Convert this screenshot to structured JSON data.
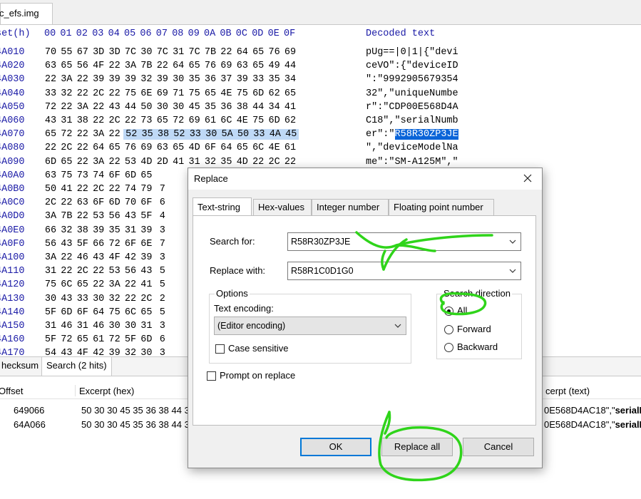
{
  "editor": {
    "file_tab": "c_efs.img",
    "header": {
      "offset_label": "set(h)",
      "columns": [
        "00",
        "01",
        "02",
        "03",
        "04",
        "05",
        "06",
        "07",
        "08",
        "09",
        "0A",
        "0B",
        "0C",
        "0D",
        "0E",
        "0F"
      ],
      "decoded_label": "Decoded text"
    },
    "rows": [
      {
        "offset": "4A010",
        "hex": [
          "70",
          "55",
          "67",
          "3D",
          "3D",
          "7C",
          "30",
          "7C",
          "31",
          "7C",
          "7B",
          "22",
          "64",
          "65",
          "76",
          "69"
        ],
        "text": "pUg==|0|1|{\"devi"
      },
      {
        "offset": "4A020",
        "hex": [
          "63",
          "65",
          "56",
          "4F",
          "22",
          "3A",
          "7B",
          "22",
          "64",
          "65",
          "76",
          "69",
          "63",
          "65",
          "49",
          "44"
        ],
        "text": "ceVO\":{\"deviceID"
      },
      {
        "offset": "4A030",
        "hex": [
          "22",
          "3A",
          "22",
          "39",
          "39",
          "39",
          "32",
          "39",
          "30",
          "35",
          "36",
          "37",
          "39",
          "33",
          "35",
          "34"
        ],
        "text": "\":\"9992905679354"
      },
      {
        "offset": "4A040",
        "hex": [
          "33",
          "32",
          "22",
          "2C",
          "22",
          "75",
          "6E",
          "69",
          "71",
          "75",
          "65",
          "4E",
          "75",
          "6D",
          "62",
          "65"
        ],
        "text": "32\",\"uniqueNumbe"
      },
      {
        "offset": "4A050",
        "hex": [
          "72",
          "22",
          "3A",
          "22",
          "43",
          "44",
          "50",
          "30",
          "30",
          "45",
          "35",
          "36",
          "38",
          "44",
          "34",
          "41"
        ],
        "text": "r\":\"CDP00E568D4A"
      },
      {
        "offset": "4A060",
        "hex": [
          "43",
          "31",
          "38",
          "22",
          "2C",
          "22",
          "73",
          "65",
          "72",
          "69",
          "61",
          "6C",
          "4E",
          "75",
          "6D",
          "62"
        ],
        "text": "C18\",\"serialNumb"
      },
      {
        "offset": "4A070",
        "hex": [
          "65",
          "72",
          "22",
          "3A",
          "22",
          "52",
          "35",
          "38",
          "52",
          "33",
          "30",
          "5A",
          "50",
          "33",
          "4A",
          "45"
        ],
        "text_plain": "er\":\"",
        "text_sel": "R58R30ZP3JE"
      },
      {
        "offset": "4A080",
        "hex": [
          "22",
          "2C",
          "22",
          "64",
          "65",
          "76",
          "69",
          "63",
          "65",
          "4D",
          "6F",
          "64",
          "65",
          "6C",
          "4E",
          "61"
        ],
        "text": "\",\"deviceModelNa"
      },
      {
        "offset": "4A090",
        "hex": [
          "6D",
          "65",
          "22",
          "3A",
          "22",
          "53",
          "4D",
          "2D",
          "41",
          "31",
          "32",
          "35",
          "4D",
          "22",
          "2C",
          "22"
        ],
        "text": "me\":\"SM-A125M\",\""
      },
      {
        "offset": "4A0A0",
        "hex": [
          "63",
          "75",
          "73",
          "74",
          "6F",
          "6D",
          "65"
        ]
      },
      {
        "offset": "4A0B0",
        "hex": [
          "50",
          "41",
          "22",
          "2C",
          "22",
          "74",
          "79",
          "7"
        ]
      },
      {
        "offset": "4A0C0",
        "hex": [
          "2C",
          "22",
          "63",
          "6F",
          "6D",
          "70",
          "6F",
          "6"
        ]
      },
      {
        "offset": "4A0D0",
        "hex": [
          "3A",
          "7B",
          "22",
          "53",
          "56",
          "43",
          "5F",
          "4"
        ]
      },
      {
        "offset": "4A0E0",
        "hex": [
          "66",
          "32",
          "38",
          "39",
          "35",
          "31",
          "39",
          "3"
        ]
      },
      {
        "offset": "4A0F0",
        "hex": [
          "56",
          "43",
          "5F",
          "66",
          "72",
          "6F",
          "6E",
          "7"
        ]
      },
      {
        "offset": "4A100",
        "hex": [
          "3A",
          "22",
          "46",
          "43",
          "4F",
          "42",
          "39",
          "3"
        ]
      },
      {
        "offset": "4A110",
        "hex": [
          "31",
          "22",
          "2C",
          "22",
          "53",
          "56",
          "43",
          "5"
        ]
      },
      {
        "offset": "4A120",
        "hex": [
          "75",
          "6C",
          "65",
          "22",
          "3A",
          "22",
          "41",
          "5"
        ]
      },
      {
        "offset": "4A130",
        "hex": [
          "30",
          "43",
          "33",
          "30",
          "32",
          "22",
          "2C",
          "2"
        ]
      },
      {
        "offset": "4A140",
        "hex": [
          "5F",
          "6D",
          "6F",
          "64",
          "75",
          "6C",
          "65",
          "5"
        ]
      },
      {
        "offset": "4A150",
        "hex": [
          "31",
          "46",
          "31",
          "46",
          "30",
          "30",
          "31",
          "3"
        ]
      },
      {
        "offset": "4A160",
        "hex": [
          "5F",
          "72",
          "65",
          "61",
          "72",
          "5F",
          "6D",
          "6"
        ]
      },
      {
        "offset": "4A170",
        "hex": [
          "54",
          "43",
          "4F",
          "42",
          "39",
          "32",
          "30",
          "3"
        ]
      }
    ]
  },
  "bottom_panel": {
    "tabs": [
      "hecksum",
      "Search (2 hits)"
    ],
    "columns": {
      "offset": "Offset",
      "excerpt_hex": "Excerpt (hex)",
      "excerpt_text": "cerpt (text)"
    },
    "results": [
      {
        "offset": "649066",
        "hex": "50 30 30 45 35 36 38 44 34",
        "text_plain": "0E568D4AC18\",\"",
        "text_bold": "serialN"
      },
      {
        "offset": "64A066",
        "hex": "50 30 30 45 35 36 38 44 34",
        "text_plain": "0E568D4AC18\",\"",
        "text_bold": "serialN"
      }
    ]
  },
  "dialog": {
    "title": "Replace",
    "tabs": [
      "Text-string",
      "Hex-values",
      "Integer number",
      "Floating point number"
    ],
    "search_label": "Search for:",
    "search_value": "R58R30ZP3JE",
    "replace_label": "Replace with:",
    "replace_value": "R58R1C0D1G0",
    "options_title": "Options",
    "encoding_label": "Text encoding:",
    "encoding_value": "(Editor encoding)",
    "case_label": "Case sensitive",
    "direction_title": "Search direction",
    "direction_options": [
      "All",
      "Forward",
      "Backward"
    ],
    "direction_selected": "All",
    "prompt_label": "Prompt on replace",
    "buttons": {
      "ok": "OK",
      "replace_all": "Replace all",
      "cancel": "Cancel"
    }
  },
  "colors": {
    "annotation": "#2fd41a",
    "hex_header": "#1a1aa6",
    "selection": "#0a64d8",
    "selection_light": "#bfd9f6",
    "default_button_border": "#0078d7"
  }
}
